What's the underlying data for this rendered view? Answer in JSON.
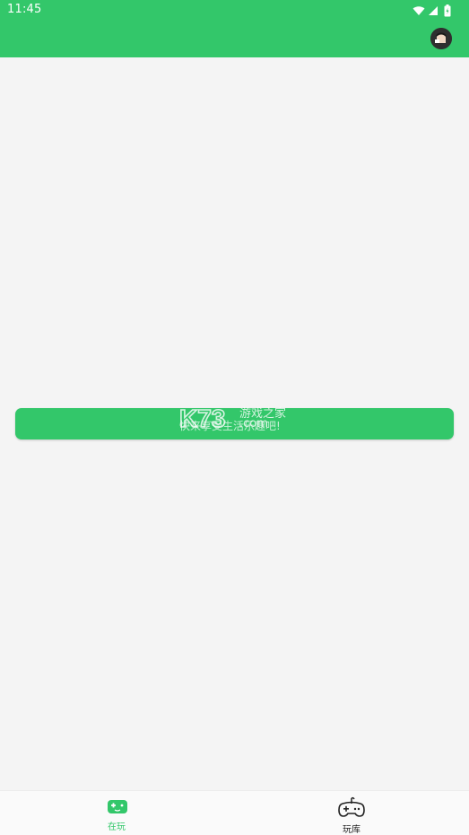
{
  "status_bar": {
    "time": "11:45",
    "icons": [
      "wifi-icon",
      "cell-signal-icon",
      "battery-icon"
    ]
  },
  "app_bar": {
    "avatar_icon": "user-avatar-icon"
  },
  "content": {
    "cta_label": "快来享受生活乐趣吧!",
    "watermark_logo": "K73",
    "watermark_line1": "游戏之家",
    "watermark_line2": ".com"
  },
  "bottom_nav": {
    "items": [
      {
        "label": "在玩",
        "icon": "gamepad-icon",
        "active": true
      },
      {
        "label": "玩库",
        "icon": "game-controller-icon",
        "active": false
      }
    ]
  },
  "colors": {
    "brand_green": "#33c76a",
    "background": "#f4f4f4",
    "nav_background": "#fafafa",
    "active_tab": "#33c76a",
    "inactive_tab": "#222222"
  }
}
